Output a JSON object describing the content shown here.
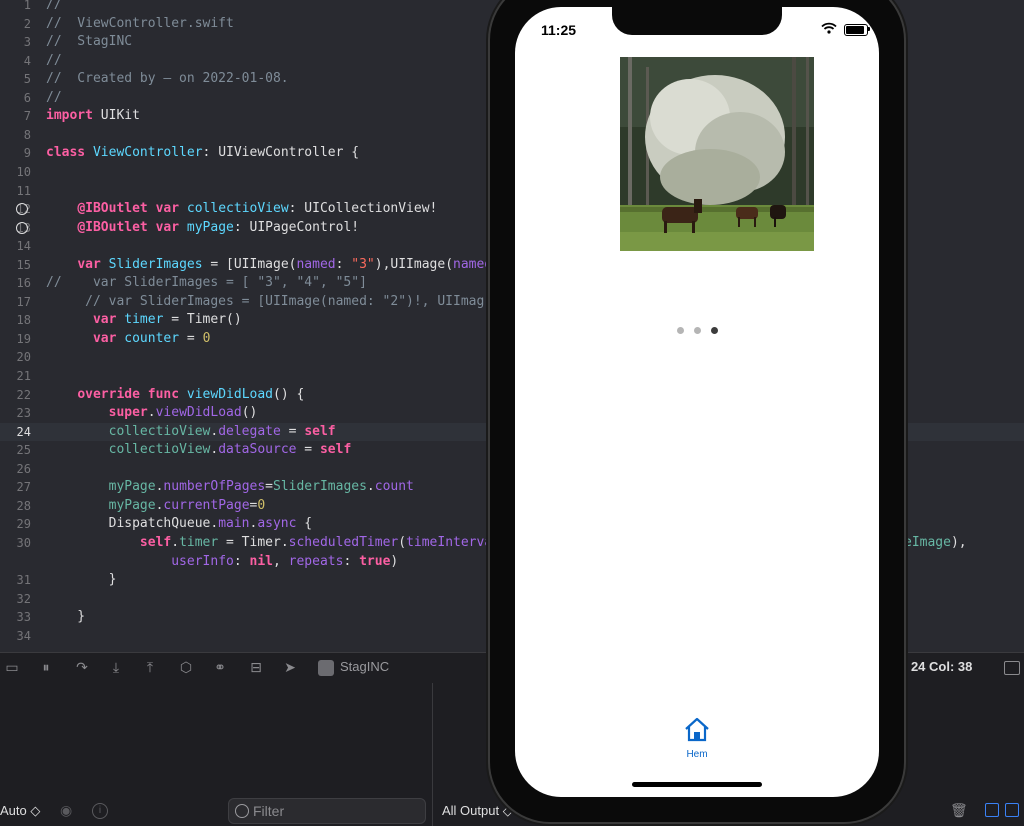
{
  "editor": {
    "lines": [
      {
        "n": "1",
        "tokens": [
          [
            "comment",
            "//"
          ]
        ]
      },
      {
        "n": "2",
        "tokens": [
          [
            "comment",
            "//  ViewController.swift"
          ]
        ]
      },
      {
        "n": "3",
        "tokens": [
          [
            "comment",
            "//  StagINC"
          ]
        ]
      },
      {
        "n": "4",
        "tokens": [
          [
            "comment",
            "//"
          ]
        ]
      },
      {
        "n": "5",
        "tokens": [
          [
            "comment",
            "//  Created by — on 2022-01-08."
          ]
        ]
      },
      {
        "n": "6",
        "tokens": [
          [
            "comment",
            "//"
          ]
        ]
      },
      {
        "n": "7",
        "tokens": [
          [
            "keyword",
            "import"
          ],
          [
            "plain",
            " UIKit"
          ]
        ]
      },
      {
        "n": "8",
        "tokens": []
      },
      {
        "n": "9",
        "tokens": [
          [
            "keyword",
            "class"
          ],
          [
            "plain",
            " "
          ],
          [
            "decl",
            "ViewController"
          ],
          [
            "plain",
            ": UIViewController {"
          ]
        ]
      },
      {
        "n": "10",
        "tokens": []
      },
      {
        "n": "11",
        "tokens": []
      },
      {
        "n": "12",
        "bp": true,
        "tokens": [
          [
            "plain",
            "    "
          ],
          [
            "keyword",
            "@IBOutlet"
          ],
          [
            "plain",
            " "
          ],
          [
            "keyword",
            "var"
          ],
          [
            "plain",
            " "
          ],
          [
            "decl",
            "collectioView"
          ],
          [
            "plain",
            ": UICollectionView!"
          ]
        ]
      },
      {
        "n": "13",
        "bp": true,
        "tokens": [
          [
            "plain",
            "    "
          ],
          [
            "keyword",
            "@IBOutlet"
          ],
          [
            "plain",
            " "
          ],
          [
            "keyword",
            "var"
          ],
          [
            "plain",
            " "
          ],
          [
            "decl",
            "myPage"
          ],
          [
            "plain",
            ": UIPageControl!"
          ]
        ]
      },
      {
        "n": "14",
        "tokens": []
      },
      {
        "n": "15",
        "tokens": [
          [
            "plain",
            "    "
          ],
          [
            "keyword",
            "var"
          ],
          [
            "plain",
            " "
          ],
          [
            "decl",
            "SliderImages"
          ],
          [
            "plain",
            " = [UIImage("
          ],
          [
            "other",
            "named"
          ],
          [
            "plain",
            ": "
          ],
          [
            "string",
            "\"3\""
          ],
          [
            "plain",
            "),UIImage("
          ],
          [
            "other",
            "named"
          ]
        ]
      },
      {
        "n": "16",
        "tokens": [
          [
            "comment",
            "//    var SliderImages = [ \"3\", \"4\", \"5\"]"
          ]
        ]
      },
      {
        "n": "17",
        "tokens": [
          [
            "comment",
            "     // var SliderImages = [UIImage(named: \"2\")!, UIImag"
          ]
        ]
      },
      {
        "n": "18",
        "tokens": [
          [
            "plain",
            "      "
          ],
          [
            "keyword",
            "var"
          ],
          [
            "plain",
            " "
          ],
          [
            "decl",
            "timer"
          ],
          [
            "plain",
            " = Timer()"
          ]
        ]
      },
      {
        "n": "19",
        "tokens": [
          [
            "plain",
            "      "
          ],
          [
            "keyword",
            "var"
          ],
          [
            "plain",
            " "
          ],
          [
            "decl",
            "counter"
          ],
          [
            "plain",
            " = "
          ],
          [
            "number",
            "0"
          ]
        ]
      },
      {
        "n": "20",
        "tokens": []
      },
      {
        "n": "21",
        "tokens": []
      },
      {
        "n": "22",
        "tokens": [
          [
            "plain",
            "    "
          ],
          [
            "keyword",
            "override"
          ],
          [
            "plain",
            " "
          ],
          [
            "keyword",
            "func"
          ],
          [
            "plain",
            " "
          ],
          [
            "decl",
            "viewDidLoad"
          ],
          [
            "plain",
            "() {"
          ]
        ]
      },
      {
        "n": "23",
        "tokens": [
          [
            "plain",
            "        "
          ],
          [
            "keyword",
            "super"
          ],
          [
            "plain",
            "."
          ],
          [
            "other",
            "viewDidLoad"
          ],
          [
            "plain",
            "()"
          ]
        ]
      },
      {
        "n": "24",
        "current": true,
        "tokens": [
          [
            "plain",
            "        "
          ],
          [
            "prop",
            "collectioView"
          ],
          [
            "plain",
            "."
          ],
          [
            "other",
            "delegate"
          ],
          [
            "plain",
            " = "
          ],
          [
            "keyword",
            "self"
          ]
        ]
      },
      {
        "n": "25",
        "tokens": [
          [
            "plain",
            "        "
          ],
          [
            "prop",
            "collectioView"
          ],
          [
            "plain",
            "."
          ],
          [
            "other",
            "dataSource"
          ],
          [
            "plain",
            " = "
          ],
          [
            "keyword",
            "self"
          ]
        ]
      },
      {
        "n": "26",
        "tokens": []
      },
      {
        "n": "27",
        "tokens": [
          [
            "plain",
            "        "
          ],
          [
            "prop",
            "myPage"
          ],
          [
            "plain",
            "."
          ],
          [
            "other",
            "numberOfPages"
          ],
          [
            "plain",
            "="
          ],
          [
            "prop",
            "SliderImages"
          ],
          [
            "plain",
            "."
          ],
          [
            "other",
            "count"
          ]
        ]
      },
      {
        "n": "28",
        "tokens": [
          [
            "plain",
            "        "
          ],
          [
            "prop",
            "myPage"
          ],
          [
            "plain",
            "."
          ],
          [
            "other",
            "currentPage"
          ],
          [
            "plain",
            "="
          ],
          [
            "number",
            "0"
          ]
        ]
      },
      {
        "n": "29",
        "tokens": [
          [
            "plain",
            "        DispatchQueue."
          ],
          [
            "other",
            "main"
          ],
          [
            "plain",
            "."
          ],
          [
            "other",
            "async"
          ],
          [
            "plain",
            " {"
          ]
        ]
      },
      {
        "n": "30",
        "tokens": [
          [
            "plain",
            "            "
          ],
          [
            "keyword",
            "self"
          ],
          [
            "plain",
            "."
          ],
          [
            "prop",
            "timer"
          ],
          [
            "plain",
            " = Timer."
          ],
          [
            "other",
            "scheduledTimer"
          ],
          [
            "plain",
            "("
          ],
          [
            "other",
            "timeInterva"
          ]
        ]
      },
      {
        "n": "",
        "tokens": [
          [
            "plain",
            "                "
          ],
          [
            "other",
            "userInfo"
          ],
          [
            "plain",
            ": "
          ],
          [
            "keyword",
            "nil"
          ],
          [
            "plain",
            ", "
          ],
          [
            "other",
            "repeats"
          ],
          [
            "plain",
            ": "
          ],
          [
            "keyword",
            "true"
          ],
          [
            "plain",
            ")"
          ]
        ]
      },
      {
        "n": "31",
        "tokens": [
          [
            "plain",
            "        }"
          ]
        ]
      },
      {
        "n": "32",
        "tokens": []
      },
      {
        "n": "33",
        "tokens": [
          [
            "plain",
            "    }"
          ]
        ]
      },
      {
        "n": "34",
        "tokens": []
      }
    ],
    "line30_tail": "eImage),"
  },
  "debug_bar": {
    "scheme": "StagINC",
    "cursor": ": 24  Col: 38"
  },
  "bottom": {
    "auto_label": "Auto ◇",
    "filter_placeholder": "Filter",
    "output_label": "All Output ◇"
  },
  "simulator": {
    "time": "11:25",
    "page_dots": {
      "count": 3,
      "current": 2
    },
    "tab_label": "Hem",
    "colors": {
      "tab_tint": "#0a67c9",
      "dot_inactive": "#b5b5b5",
      "dot_active": "#3c3c3c"
    }
  }
}
